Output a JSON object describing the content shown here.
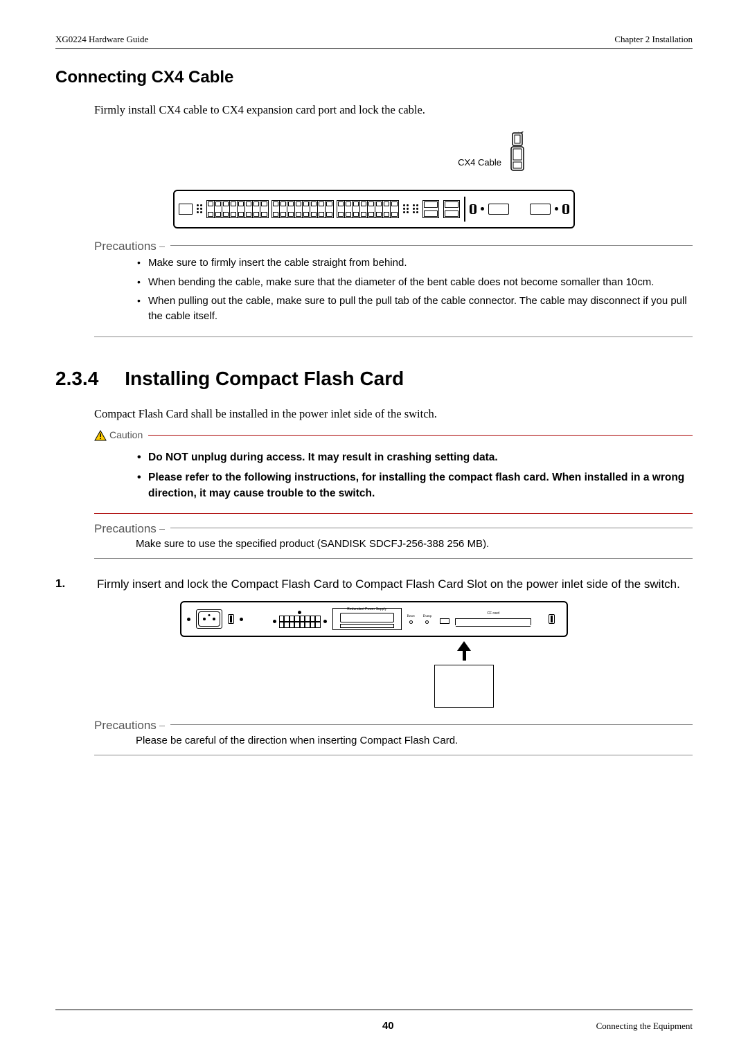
{
  "header": {
    "left": "XG0224 Hardware Guide",
    "right": "Chapter 2 Installation"
  },
  "section1": {
    "title": "Connecting CX4 Cable",
    "intro": "Firmly install CX4 cable to CX4 expansion card port and lock the cable.",
    "figure_label": "CX4 Cable"
  },
  "precautions1": {
    "title": "Precautions",
    "items": [
      "Make sure to firmly insert the cable straight from behind.",
      "When bending the cable, make sure that the diameter of the bent cable does not become somaller than 10cm.",
      "When pulling out the cable, make sure to pull the pull tab of the cable connector. The cable may disconnect if you pull the cable itself."
    ]
  },
  "section2": {
    "number": "2.3.4",
    "title": "Installing Compact Flash Card",
    "intro": "Compact Flash Card shall be installed in the power inlet side of the switch."
  },
  "caution": {
    "label": "Caution",
    "items": [
      "Do NOT unplug during access. It may result in crashing setting data.",
      "Please refer to the following instructions, for installing the compact flash card. When installed in a wrong direction, it may cause trouble to the switch."
    ]
  },
  "precautions2": {
    "title": "Precautions",
    "text": "Make sure to use the specified product (SANDISK SDCFJ-256-388 256 MB)."
  },
  "step1": {
    "num": "1.",
    "text": "Firmly insert and lock the Compact Flash Card to Compact Flash Card Slot on the power inlet side of the switch."
  },
  "rear_figure": {
    "psu_label": "Redundant Power Supply",
    "reset_label": "Reset",
    "dump_label": "Dump",
    "cf_label": "CF card"
  },
  "precautions3": {
    "title": "Precautions",
    "text": "Please be careful of the direction when inserting Compact Flash Card."
  },
  "footer": {
    "page": "40",
    "right": "Connecting the Equipment"
  }
}
